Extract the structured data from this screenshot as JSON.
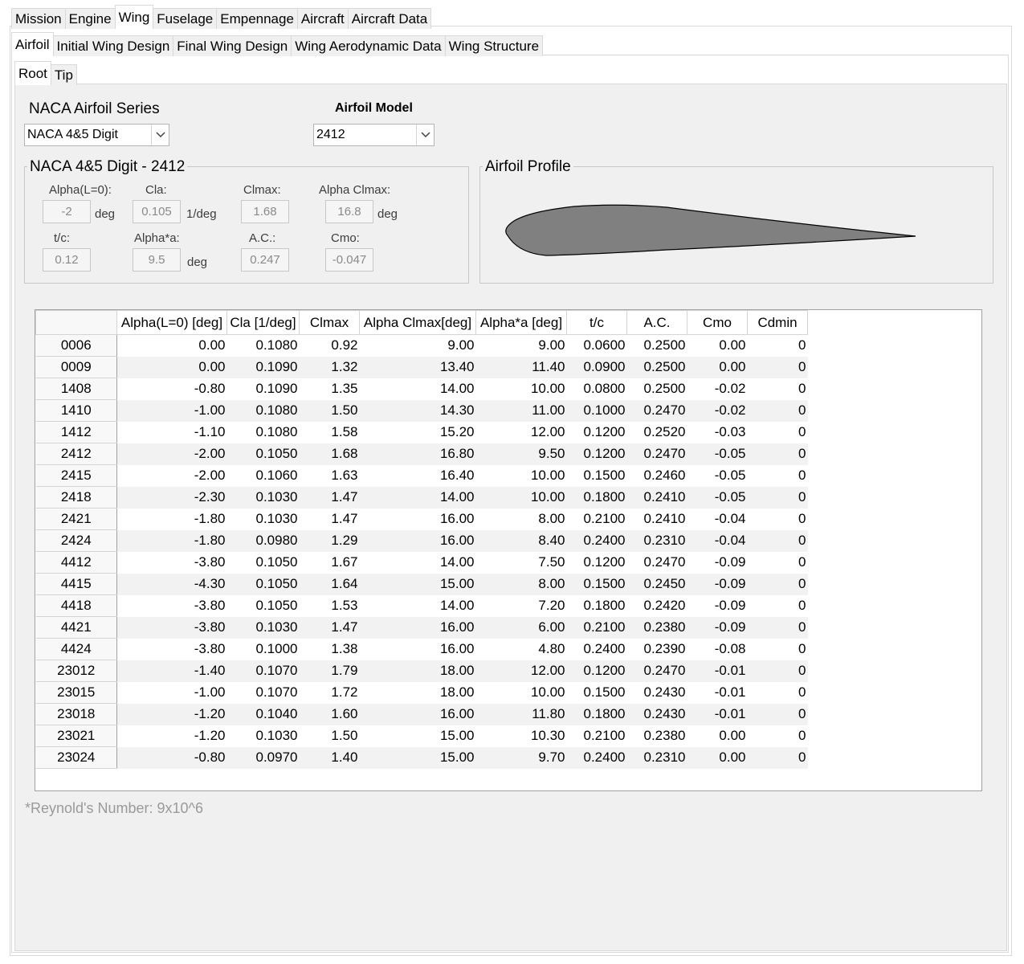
{
  "tabs_main": [
    "Mission",
    "Engine",
    "Wing",
    "Fuselage",
    "Empennage",
    "Aircraft",
    "Aircraft Data"
  ],
  "tabs_main_active": 2,
  "tabs_wing": [
    "Airfoil",
    "Initial Wing Design",
    "Final Wing Design",
    "Wing Aerodynamic Data",
    "Wing Structure"
  ],
  "tabs_wing_active": 0,
  "tabs_airfoil": [
    "Root",
    "Tip"
  ],
  "tabs_airfoil_active": 0,
  "series": {
    "label": "NACA Airfoil Series",
    "value": "NACA 4&5 Digit"
  },
  "model": {
    "label": "Airfoil Model",
    "value": "2412"
  },
  "props": {
    "title": "NACA 4&5 Digit - 2412",
    "alpha_l0": {
      "label": "Alpha(L=0):",
      "value": "-2",
      "unit": "deg"
    },
    "cla": {
      "label": "Cla:",
      "value": "0.105",
      "unit": "1/deg"
    },
    "clmax": {
      "label": "Clmax:",
      "value": "1.68"
    },
    "alpha_clmax": {
      "label": "Alpha Clmax:",
      "value": "16.8",
      "unit": "deg"
    },
    "tc": {
      "label": "t/c:",
      "value": "0.12"
    },
    "alpha_a": {
      "label": "Alpha*a:",
      "value": "9.5",
      "unit": "deg"
    },
    "ac": {
      "label": "A.C.:",
      "value": "0.247"
    },
    "cmo": {
      "label": "Cmo:",
      "value": "-0.047"
    }
  },
  "profile": {
    "title": "Airfoil Profile"
  },
  "table": {
    "columns": [
      "Alpha(L=0) [deg]",
      "Cla [1/deg]",
      "Clmax",
      "Alpha Clmax[deg]",
      "Alpha*a [deg]",
      "t/c",
      "A.C.",
      "Cmo",
      "Cdmin"
    ],
    "rows": [
      [
        "0006",
        "0.00",
        "0.1080",
        "0.92",
        "9.00",
        "9.00",
        "0.0600",
        "0.2500",
        "0.00",
        "0"
      ],
      [
        "0009",
        "0.00",
        "0.1090",
        "1.32",
        "13.40",
        "11.40",
        "0.0900",
        "0.2500",
        "0.00",
        "0"
      ],
      [
        "1408",
        "-0.80",
        "0.1090",
        "1.35",
        "14.00",
        "10.00",
        "0.0800",
        "0.2500",
        "-0.02",
        "0"
      ],
      [
        "1410",
        "-1.00",
        "0.1080",
        "1.50",
        "14.30",
        "11.00",
        "0.1000",
        "0.2470",
        "-0.02",
        "0"
      ],
      [
        "1412",
        "-1.10",
        "0.1080",
        "1.58",
        "15.20",
        "12.00",
        "0.1200",
        "0.2520",
        "-0.03",
        "0"
      ],
      [
        "2412",
        "-2.00",
        "0.1050",
        "1.68",
        "16.80",
        "9.50",
        "0.1200",
        "0.2470",
        "-0.05",
        "0"
      ],
      [
        "2415",
        "-2.00",
        "0.1060",
        "1.63",
        "16.40",
        "10.00",
        "0.1500",
        "0.2460",
        "-0.05",
        "0"
      ],
      [
        "2418",
        "-2.30",
        "0.1030",
        "1.47",
        "14.00",
        "10.00",
        "0.1800",
        "0.2410",
        "-0.05",
        "0"
      ],
      [
        "2421",
        "-1.80",
        "0.1030",
        "1.47",
        "16.00",
        "8.00",
        "0.2100",
        "0.2410",
        "-0.04",
        "0"
      ],
      [
        "2424",
        "-1.80",
        "0.0980",
        "1.29",
        "16.00",
        "8.40",
        "0.2400",
        "0.2310",
        "-0.04",
        "0"
      ],
      [
        "4412",
        "-3.80",
        "0.1050",
        "1.67",
        "14.00",
        "7.50",
        "0.1200",
        "0.2470",
        "-0.09",
        "0"
      ],
      [
        "4415",
        "-4.30",
        "0.1050",
        "1.64",
        "15.00",
        "8.00",
        "0.1500",
        "0.2450",
        "-0.09",
        "0"
      ],
      [
        "4418",
        "-3.80",
        "0.1050",
        "1.53",
        "14.00",
        "7.20",
        "0.1800",
        "0.2420",
        "-0.09",
        "0"
      ],
      [
        "4421",
        "-3.80",
        "0.1030",
        "1.47",
        "16.00",
        "6.00",
        "0.2100",
        "0.2380",
        "-0.09",
        "0"
      ],
      [
        "4424",
        "-3.80",
        "0.1000",
        "1.38",
        "16.00",
        "4.80",
        "0.2400",
        "0.2390",
        "-0.08",
        "0"
      ],
      [
        "23012",
        "-1.40",
        "0.1070",
        "1.79",
        "18.00",
        "12.00",
        "0.1200",
        "0.2470",
        "-0.01",
        "0"
      ],
      [
        "23015",
        "-1.00",
        "0.1070",
        "1.72",
        "18.00",
        "10.00",
        "0.1500",
        "0.2430",
        "-0.01",
        "0"
      ],
      [
        "23018",
        "-1.20",
        "0.1040",
        "1.60",
        "16.00",
        "11.80",
        "0.1800",
        "0.2430",
        "-0.01",
        "0"
      ],
      [
        "23021",
        "-1.20",
        "0.1030",
        "1.50",
        "15.00",
        "10.30",
        "0.2100",
        "0.2380",
        "0.00",
        "0"
      ],
      [
        "23024",
        "-0.80",
        "0.0970",
        "1.40",
        "15.00",
        "9.70",
        "0.2400",
        "0.2310",
        "0.00",
        "0"
      ]
    ]
  },
  "footnote": "*Reynold's Number: 9x10^6",
  "colors": {
    "airfoil_fill": "#808080",
    "panel_bg": "#f0f0f0",
    "stripe": "#f2f2f2"
  },
  "icons": {
    "dropdown": "chevron-down-icon"
  }
}
